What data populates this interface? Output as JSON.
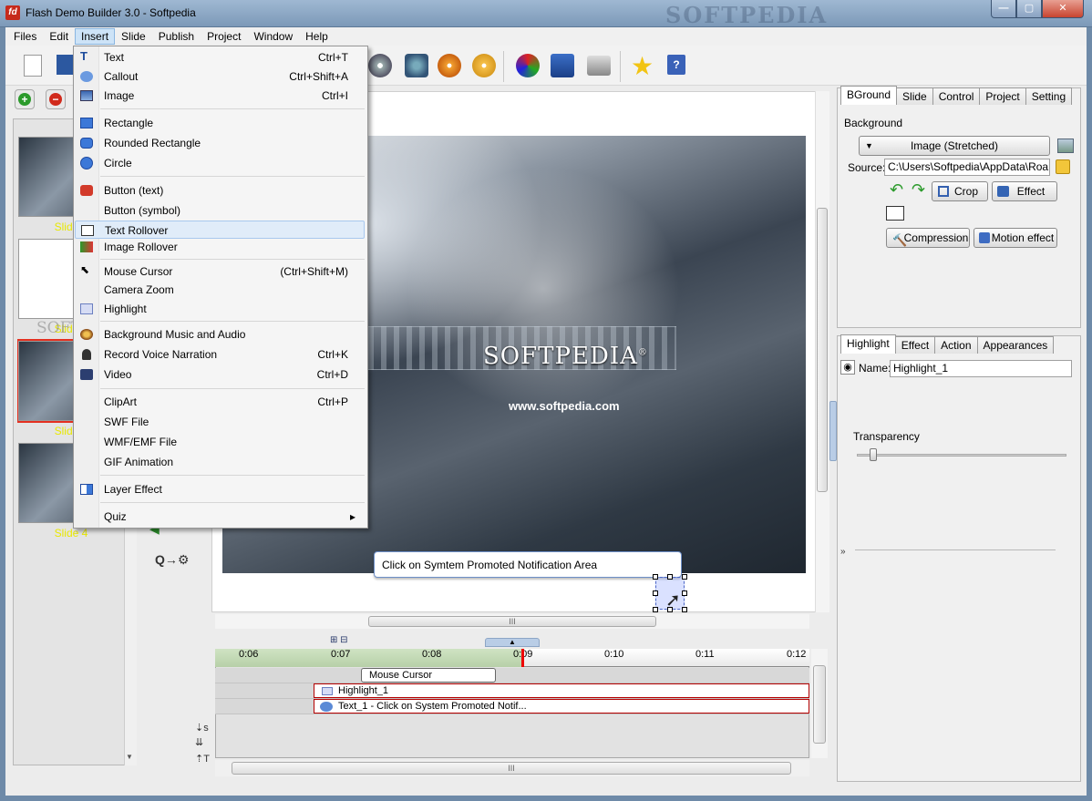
{
  "window": {
    "title": "Flash Demo Builder 3.0 - Softpedia",
    "watermark": "SOFTPEDIA",
    "app_icon_text": "fd"
  },
  "menubar": [
    "Files",
    "Edit",
    "Insert",
    "Slide",
    "Publish",
    "Project",
    "Window",
    "Help"
  ],
  "active_menu": "Insert",
  "insert_menu": {
    "items": [
      {
        "label": "Text",
        "shortcut": "Ctrl+T",
        "icon": "text-icon"
      },
      {
        "label": "Callout",
        "shortcut": "Ctrl+Shift+A",
        "icon": "callout-icon"
      },
      {
        "label": "Image",
        "shortcut": "Ctrl+I",
        "icon": "image-icon"
      },
      {
        "label": "Rectangle",
        "shortcut": "",
        "icon": "rectangle-icon"
      },
      {
        "label": "Rounded Rectangle",
        "shortcut": "",
        "icon": "rounded-rectangle-icon"
      },
      {
        "label": "Circle",
        "shortcut": "",
        "icon": "circle-icon"
      },
      {
        "label": "Button (text)",
        "shortcut": "",
        "icon": "button-text-icon"
      },
      {
        "label": "Button (symbol)",
        "shortcut": "",
        "icon": ""
      },
      {
        "label": "Text Rollover",
        "shortcut": "",
        "icon": "text-rollover-icon"
      },
      {
        "label": "Image Rollover",
        "shortcut": "",
        "icon": "image-rollover-icon"
      },
      {
        "label": "Mouse Cursor",
        "shortcut": "(Ctrl+Shift+M)",
        "icon": "mouse-cursor-icon"
      },
      {
        "label": "Camera Zoom",
        "shortcut": "",
        "icon": ""
      },
      {
        "label": "Highlight",
        "shortcut": "",
        "icon": "highlight-icon"
      },
      {
        "label": "Background Music and Audio",
        "shortcut": "",
        "icon": "music-icon"
      },
      {
        "label": "Record Voice Narration",
        "shortcut": "Ctrl+K",
        "icon": "microphone-icon"
      },
      {
        "label": "Video",
        "shortcut": "Ctrl+D",
        "icon": "video-icon"
      },
      {
        "label": "ClipArt",
        "shortcut": "Ctrl+P",
        "icon": ""
      },
      {
        "label": "SWF File",
        "shortcut": "",
        "icon": ""
      },
      {
        "label": "WMF/EMF File",
        "shortcut": "",
        "icon": ""
      },
      {
        "label": "GIF Animation",
        "shortcut": "",
        "icon": ""
      },
      {
        "label": "Layer Effect",
        "shortcut": "",
        "icon": "layer-effect-icon"
      },
      {
        "label": "Quiz",
        "shortcut": "",
        "icon": "",
        "submenu_arrow": "▸"
      }
    ],
    "hovered": "Text Rollover"
  },
  "slides": {
    "labels": [
      "Slide 1",
      "Slide 2",
      "Slide 3",
      "Slide 4"
    ],
    "selected": "Slide 3",
    "overlay_watermark": "SOFTPEDIA"
  },
  "stage": {
    "brand": "SOFTPEDIA",
    "brand_mark": "®",
    "url": "www.softpedia.com",
    "callout_text": "Click on Symtem Promoted Notification Area"
  },
  "timeline": {
    "ticks": [
      "0:06",
      "0:07",
      "0:08",
      "0:09",
      "0:10",
      "0:11",
      "0:12"
    ],
    "tracks": [
      {
        "label": "Mouse Cursor"
      },
      {
        "label": "Highlight_1"
      },
      {
        "label": "Text_1 - Click on System Promoted Notif..."
      }
    ],
    "scroll_grip": "III"
  },
  "properties_top": {
    "tabs": [
      "BGround",
      "Slide",
      "Control",
      "Project",
      "Setting"
    ],
    "active_tab": "BGround",
    "section_label": "Background",
    "mode_value": "Image (Stretched)",
    "source_label": "Source:",
    "source_value": "C:\\Users\\Softpedia\\AppData\\Roami",
    "crop_label": "Crop",
    "effect_label": "Effect",
    "compression_label": "Compression",
    "motion_effect_label": "Motion effect"
  },
  "properties_bottom": {
    "tabs": [
      "Highlight",
      "Effect",
      "Action",
      "Appearances"
    ],
    "active_tab": "Highlight",
    "name_label": "Name:",
    "name_value": "Highlight_1",
    "transparency_label": "Transparency",
    "transparency_level": 0.08
  },
  "colors": {
    "accent_red": "#c62a1c",
    "slide_label": "#e8e800",
    "selection": "#e0ecf9"
  }
}
